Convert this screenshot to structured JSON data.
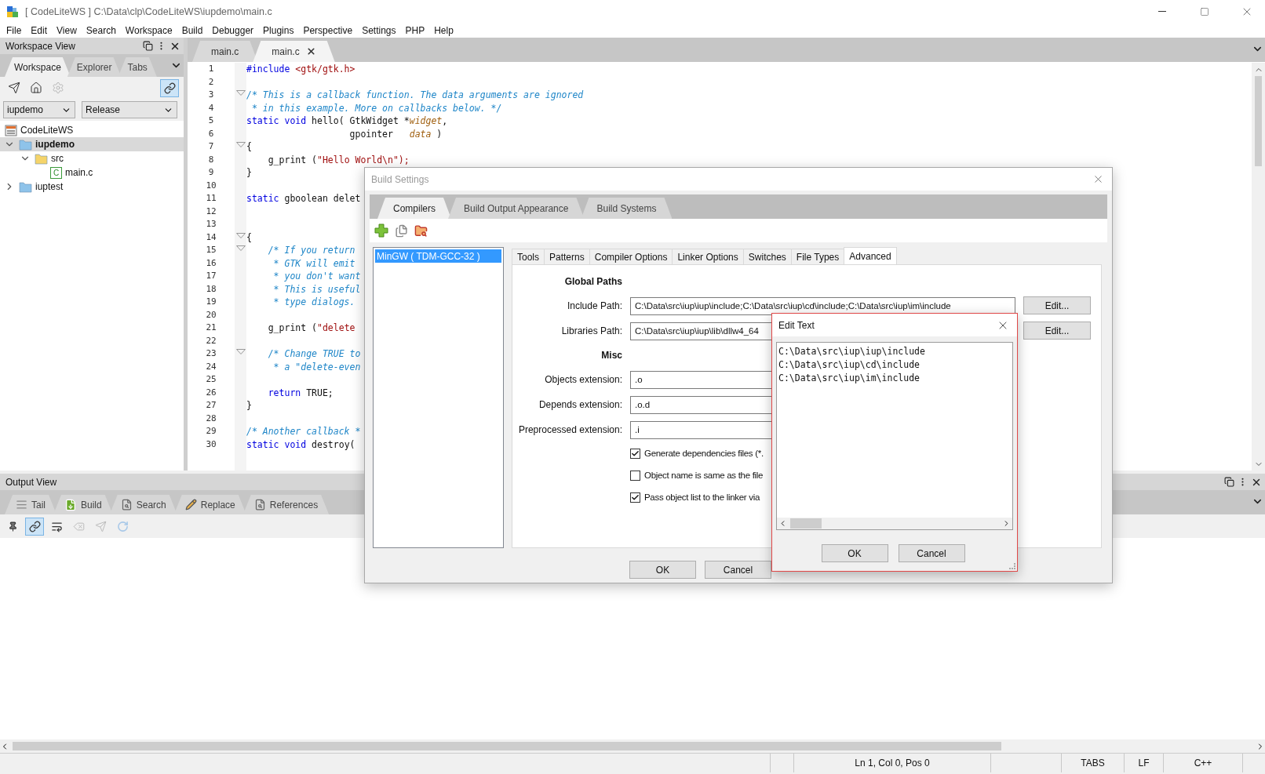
{
  "window": {
    "title": "[ CodeLiteWS ] C:\\Data\\clp\\CodeLiteWS\\iupdemo\\main.c"
  },
  "menu": [
    "File",
    "Edit",
    "View",
    "Search",
    "Workspace",
    "Build",
    "Debugger",
    "Plugins",
    "Perspective",
    "Settings",
    "PHP",
    "Help"
  ],
  "workspace_view": {
    "title": "Workspace View",
    "tabs": [
      {
        "label": "Workspace",
        "selected": true
      },
      {
        "label": "Explorer",
        "selected": false
      },
      {
        "label": "Tabs",
        "selected": false
      }
    ],
    "toolbar": [
      {
        "kind": "send",
        "active": false,
        "disabled": false
      },
      {
        "kind": "home",
        "active": false,
        "disabled": false
      },
      {
        "kind": "settings",
        "active": false,
        "disabled": true
      },
      {
        "kind": "link",
        "active": true,
        "disabled": false
      }
    ],
    "project_select": "iupdemo",
    "config_select": "Release",
    "tree": [
      {
        "label": "CodeLiteWS",
        "kind": "workspace",
        "selected": false,
        "children": [
          {
            "label": "iupdemo",
            "kind": "project",
            "expanded": true,
            "selected": true,
            "children": [
              {
                "label": "src",
                "kind": "folder",
                "expanded": true,
                "selected": false,
                "children": [
                  {
                    "label": "main.c",
                    "kind": "file",
                    "icon_label": "C",
                    "selected": false
                  }
                ]
              }
            ]
          },
          {
            "label": "iuptest",
            "kind": "project",
            "expanded": false,
            "selected": false
          }
        ]
      }
    ]
  },
  "editor": {
    "tabs": [
      {
        "label": "main.c",
        "selected": false
      },
      {
        "label": "main.c",
        "selected": true
      }
    ],
    "lines": [
      {
        "n": "1",
        "fold": false,
        "tokens": [
          {
            "kind": "preproc",
            "s": "#include "
          },
          {
            "kind": "string",
            "s": "<gtk/gtk.h>"
          }
        ]
      },
      {
        "n": "2",
        "fold": false
      },
      {
        "n": "3",
        "fold": true,
        "tokens": [
          {
            "kind": "comment",
            "s": "/* This is a callback function. The data arguments are ignored"
          }
        ]
      },
      {
        "n": "4",
        "fold": false,
        "tokens": [
          {
            "kind": "comment",
            "s": " * in this example. More on callbacks below. */"
          }
        ]
      },
      {
        "n": "5",
        "fold": false,
        "tokens": [
          {
            "kind": "keyword",
            "s": "static void"
          },
          {
            "kind": "plain",
            "s": " hello( GtkWidget *"
          },
          {
            "kind": "param",
            "s": "widget"
          },
          {
            "kind": "plain",
            "s": ","
          }
        ]
      },
      {
        "n": "6",
        "fold": false,
        "tokens": [
          {
            "kind": "plain",
            "s": "                   gpointer   "
          },
          {
            "kind": "param",
            "s": "data"
          },
          {
            "kind": "plain",
            "s": " )"
          }
        ]
      },
      {
        "n": "7",
        "fold": true,
        "tokens": [
          {
            "kind": "plain",
            "s": "{"
          }
        ]
      },
      {
        "n": "8",
        "fold": false,
        "tokens": [
          {
            "kind": "plain",
            "s": "    g_print ("
          },
          {
            "kind": "string",
            "s": "\"Hello World\\n\");"
          }
        ]
      },
      {
        "n": "9",
        "fold": false,
        "tokens": [
          {
            "kind": "plain",
            "s": "}"
          }
        ]
      },
      {
        "n": "10",
        "fold": false
      },
      {
        "n": "11",
        "fold": false,
        "tokens": [
          {
            "kind": "keyword",
            "s": "static"
          },
          {
            "kind": "plain",
            "s": " gboolean delet"
          }
        ]
      },
      {
        "n": "12",
        "fold": false
      },
      {
        "n": "13",
        "fold": false
      },
      {
        "n": "14",
        "fold": true,
        "tokens": [
          {
            "kind": "plain",
            "s": "{"
          }
        ]
      },
      {
        "n": "15",
        "fold": true,
        "tokens": [
          {
            "kind": "comment",
            "s": "    /* If you return"
          }
        ]
      },
      {
        "n": "16",
        "fold": false,
        "tokens": [
          {
            "kind": "comment",
            "s": "     * GTK will emit"
          }
        ]
      },
      {
        "n": "17",
        "fold": false,
        "tokens": [
          {
            "kind": "comment",
            "s": "     * you don't want"
          }
        ]
      },
      {
        "n": "18",
        "fold": false,
        "tokens": [
          {
            "kind": "comment",
            "s": "     * This is useful"
          }
        ]
      },
      {
        "n": "19",
        "fold": false,
        "tokens": [
          {
            "kind": "comment",
            "s": "     * type dialogs."
          }
        ]
      },
      {
        "n": "20",
        "fold": false
      },
      {
        "n": "21",
        "fold": false,
        "tokens": [
          {
            "kind": "plain",
            "s": "    g_print ("
          },
          {
            "kind": "string",
            "s": "\"delete"
          }
        ]
      },
      {
        "n": "22",
        "fold": false
      },
      {
        "n": "23",
        "fold": true,
        "tokens": [
          {
            "kind": "comment",
            "s": "    /* Change TRUE to"
          }
        ]
      },
      {
        "n": "24",
        "fold": false,
        "tokens": [
          {
            "kind": "comment",
            "s": "     * a \"delete-even"
          }
        ]
      },
      {
        "n": "25",
        "fold": false
      },
      {
        "n": "26",
        "fold": false,
        "tokens": [
          {
            "kind": "keyword",
            "s": "    return"
          },
          {
            "kind": "plain",
            "s": " TRUE;"
          }
        ]
      },
      {
        "n": "27",
        "fold": false,
        "tokens": [
          {
            "kind": "plain",
            "s": "}"
          }
        ]
      },
      {
        "n": "28",
        "fold": false
      },
      {
        "n": "29",
        "fold": false,
        "tokens": [
          {
            "kind": "comment",
            "s": "/* Another callback *"
          }
        ]
      },
      {
        "n": "30",
        "fold": false,
        "tokens": [
          {
            "kind": "keyword",
            "s": "static void"
          },
          {
            "kind": "plain",
            "s": " destroy( "
          }
        ]
      }
    ]
  },
  "output_view": {
    "title": "Output View",
    "tabs": [
      {
        "label": "Tail",
        "kind": "tail",
        "selected": false
      },
      {
        "label": "Build",
        "kind": "build",
        "selected": false
      },
      {
        "label": "Search",
        "kind": "search",
        "selected": false
      },
      {
        "label": "Replace",
        "kind": "replace",
        "selected": false
      },
      {
        "label": "References",
        "kind": "references",
        "selected": false
      }
    ],
    "toolbar": [
      {
        "kind": "pin",
        "active": false,
        "disabled": false
      },
      {
        "kind": "link",
        "active": true,
        "disabled": false
      },
      {
        "kind": "wrap",
        "active": false,
        "disabled": false
      },
      {
        "kind": "clear",
        "active": false,
        "disabled": true
      },
      {
        "kind": "send",
        "active": false,
        "disabled": true
      },
      {
        "kind": "refresh",
        "active": false,
        "disabled": true
      }
    ]
  },
  "status_bar": {
    "position": "Ln 1, Col 0, Pos 0",
    "indent": "TABS",
    "eol": "LF",
    "language": "C++"
  },
  "build_settings": {
    "title": "Build Settings",
    "tabs": [
      {
        "label": "Compilers",
        "selected": true
      },
      {
        "label": "Build Output Appearance",
        "selected": false
      },
      {
        "label": "Build Systems",
        "selected": false
      }
    ],
    "toolbar": [
      {
        "kind": "add"
      },
      {
        "kind": "copy"
      },
      {
        "kind": "scan"
      }
    ],
    "compilers": [
      {
        "label": "MinGW ( TDM-GCC-32 )",
        "selected": true
      }
    ],
    "option_tabs": [
      {
        "label": "Tools",
        "selected": false
      },
      {
        "label": "Patterns",
        "selected": false
      },
      {
        "label": "Compiler Options",
        "selected": false
      },
      {
        "label": "Linker Options",
        "selected": false
      },
      {
        "label": "Switches",
        "selected": false
      },
      {
        "label": "File Types",
        "selected": false
      },
      {
        "label": "Advanced",
        "selected": true
      }
    ],
    "rows": [
      {
        "kind": "heading",
        "label": "Global Paths"
      },
      {
        "kind": "path",
        "label": "Include Path:",
        "value": "C:\\Data\\src\\iup\\iup\\include;C:\\Data\\src\\iup\\cd\\include;C:\\Data\\src\\iup\\im\\include",
        "button": "Edit..."
      },
      {
        "kind": "path",
        "label": "Libraries Path:",
        "value": "C:\\Data\\src\\iup\\iup\\lib\\dllw4_64",
        "button": "Edit..."
      },
      {
        "kind": "heading",
        "label": "Misc"
      },
      {
        "kind": "field",
        "label": "Objects extension:",
        "value": ".o"
      },
      {
        "kind": "field",
        "label": "Depends extension:",
        "value": ".o.d"
      },
      {
        "kind": "field",
        "label": "Preprocessed extension:",
        "value": ".i"
      },
      {
        "kind": "checkbox",
        "label": "Generate dependencies files (*.",
        "checked": true
      },
      {
        "kind": "checkbox",
        "label": "Object name is same as the file",
        "checked": false
      },
      {
        "kind": "checkbox",
        "label": "Pass object list to the linker via",
        "checked": true
      }
    ],
    "buttons": [
      "OK",
      "Cancel"
    ]
  },
  "edit_text": {
    "title": "Edit Text",
    "lines": [
      "C:\\Data\\src\\iup\\iup\\include",
      "C:\\Data\\src\\iup\\cd\\include",
      "C:\\Data\\src\\iup\\im\\include"
    ],
    "buttons": [
      "OK",
      "Cancel"
    ]
  }
}
